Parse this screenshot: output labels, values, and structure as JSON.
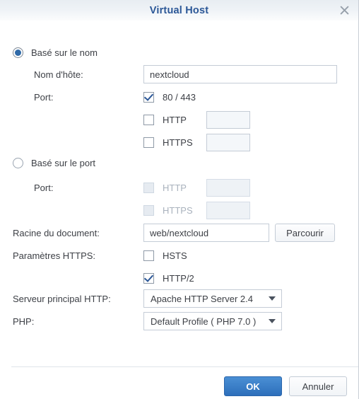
{
  "dialog": {
    "title": "Virtual Host",
    "close_icon": "close-icon"
  },
  "name_based": {
    "radio_label": "Basé sur le nom",
    "selected": true,
    "hostname": {
      "label": "Nom d'hôte:",
      "value": "nextcloud",
      "placeholder": ""
    },
    "port": {
      "label": "Port:",
      "options": [
        {
          "label": "80 / 443",
          "checked": true,
          "has_input": false,
          "input_value": ""
        },
        {
          "label": "HTTP",
          "checked": false,
          "has_input": true,
          "input_value": ""
        },
        {
          "label": "HTTPS",
          "checked": false,
          "has_input": true,
          "input_value": ""
        }
      ]
    }
  },
  "port_based": {
    "radio_label": "Basé sur le port",
    "selected": false,
    "port": {
      "label": "Port:",
      "options": [
        {
          "label": "HTTP",
          "checked": false,
          "input_value": ""
        },
        {
          "label": "HTTPS",
          "checked": false,
          "input_value": ""
        }
      ]
    }
  },
  "document_root": {
    "label": "Racine du document:",
    "value": "web/nextcloud",
    "browse_label": "Parcourir"
  },
  "https_settings": {
    "label": "Paramètres HTTPS:",
    "options": [
      {
        "label": "HSTS",
        "checked": false
      },
      {
        "label": "HTTP/2",
        "checked": true
      }
    ]
  },
  "http_backend": {
    "label": "Serveur principal HTTP:",
    "value": "Apache HTTP Server 2.4"
  },
  "php": {
    "label": "PHP:",
    "value": "Default Profile ( PHP 7.0 )"
  },
  "footer": {
    "ok_label": "OK",
    "cancel_label": "Annuler"
  },
  "colors": {
    "title": "#2b5797",
    "primary_button": "#2d6fbb",
    "accent": "#2f6aa8"
  }
}
